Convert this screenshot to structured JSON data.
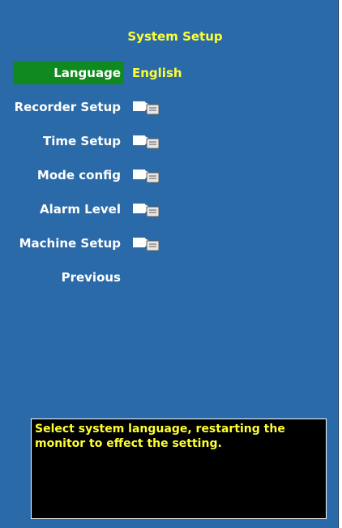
{
  "window": {
    "title": "System Setup"
  },
  "menu": {
    "items": [
      {
        "label": "Language",
        "value": "English",
        "icon": null,
        "selected": true
      },
      {
        "label": "Recorder Setup",
        "value": "",
        "icon": "submenu-folder-icon",
        "selected": false
      },
      {
        "label": "Time Setup",
        "value": "",
        "icon": "submenu-folder-icon",
        "selected": false
      },
      {
        "label": "Mode config",
        "value": "",
        "icon": "submenu-folder-icon",
        "selected": false
      },
      {
        "label": "Alarm Level",
        "value": "",
        "icon": "submenu-folder-icon",
        "selected": false
      },
      {
        "label": "Machine Setup",
        "value": "",
        "icon": "submenu-folder-icon",
        "selected": false
      },
      {
        "label": "Previous",
        "value": "",
        "icon": null,
        "selected": false
      }
    ]
  },
  "help": {
    "text": "Select system language, restarting the monitor to effect the setting."
  },
  "colors": {
    "background": "#2a6aa8",
    "selection": "#0e8a1e",
    "title_text": "#ffff33",
    "label_text": "#ffffff",
    "help_background": "#000000",
    "help_text": "#ffff33"
  }
}
